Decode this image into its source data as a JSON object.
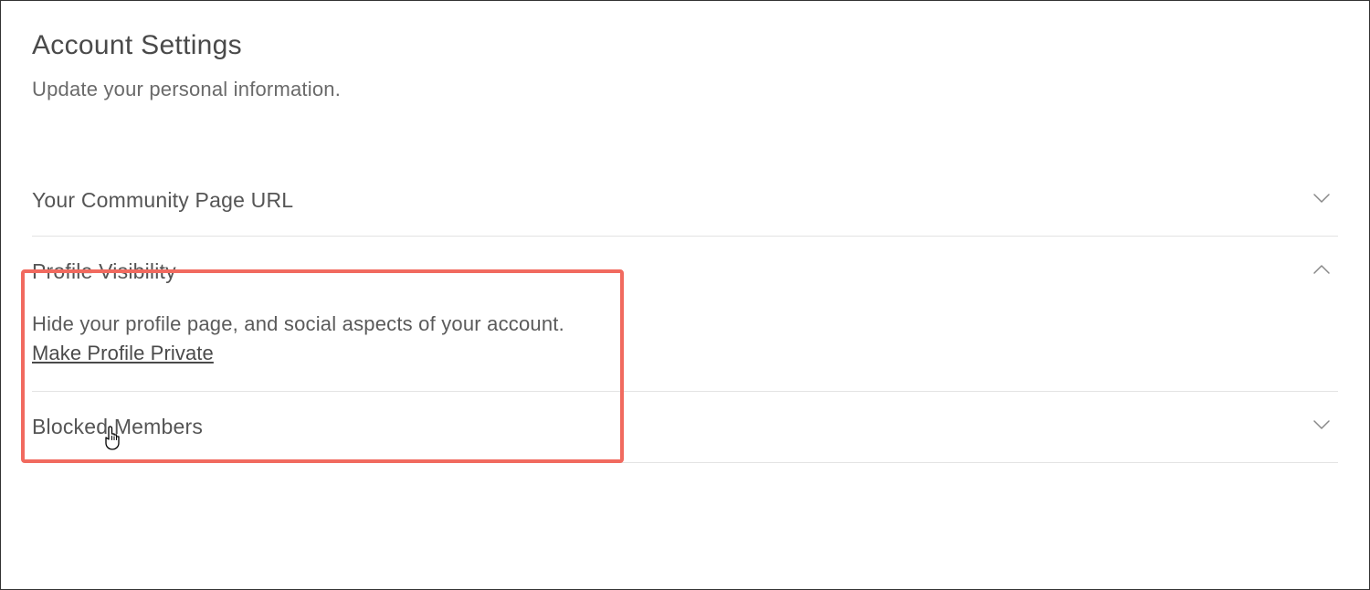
{
  "header": {
    "title": "Account Settings",
    "subtitle": "Update your personal information."
  },
  "sections": {
    "communityUrl": {
      "title": "Your Community Page URL"
    },
    "profileVisibility": {
      "title": "Profile Visibility",
      "description": "Hide your profile page, and social aspects of your account.",
      "actionLabel": "Make Profile Private"
    },
    "blockedMembers": {
      "title": "Blocked Members"
    }
  }
}
